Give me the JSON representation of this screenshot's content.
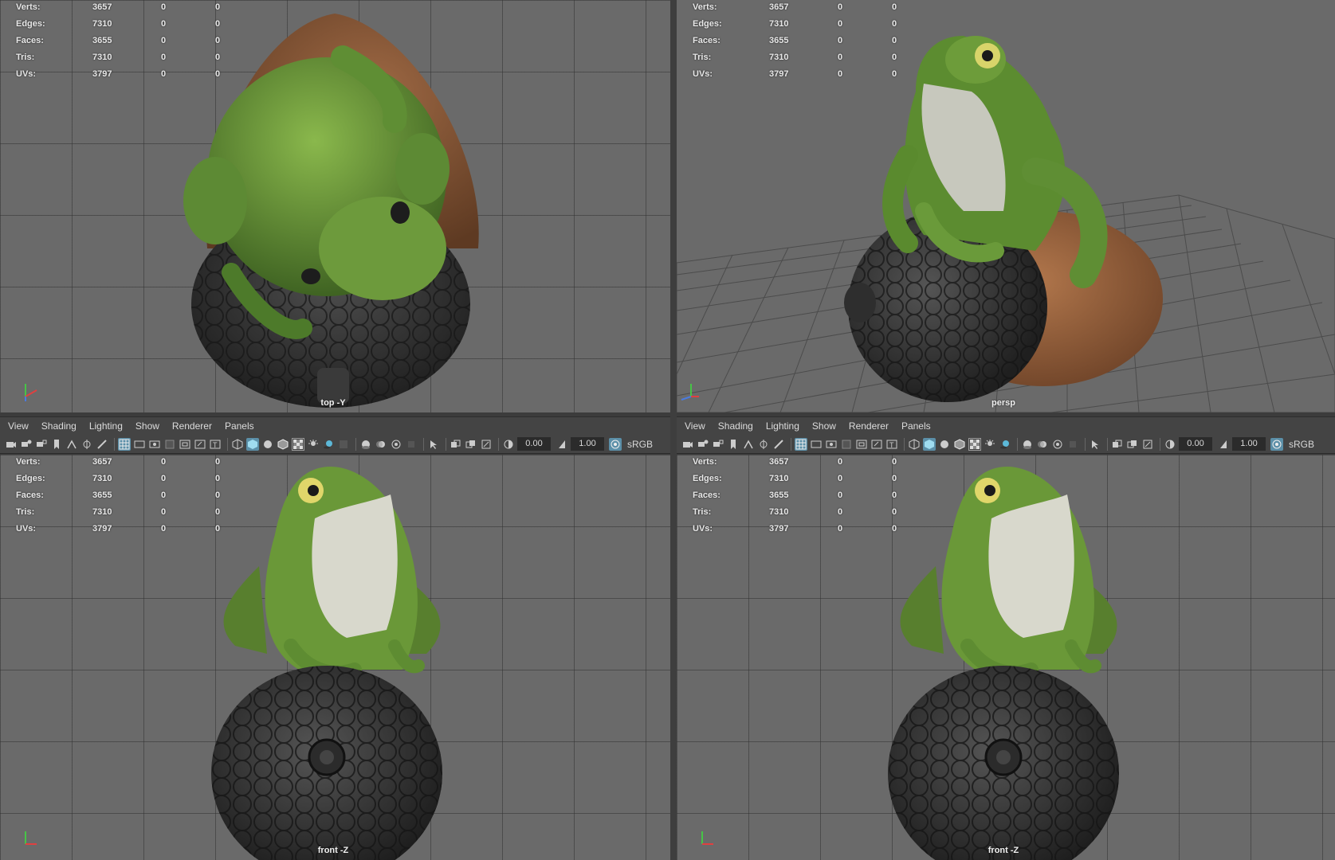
{
  "hud_labels": [
    "Verts:",
    "Edges:",
    "Faces:",
    "Tris:",
    "UVs:"
  ],
  "hud_values": [
    [
      "3657",
      "0",
      "0"
    ],
    [
      "7310",
      "0",
      "0"
    ],
    [
      "3655",
      "0",
      "0"
    ],
    [
      "7310",
      "0",
      "0"
    ],
    [
      "3797",
      "0",
      "0"
    ]
  ],
  "viewports": {
    "top_left": {
      "camera": "top -Y"
    },
    "top_right": {
      "camera": "persp"
    },
    "bottom_left": {
      "camera": "front -Z"
    },
    "bottom_right": {
      "camera": "front -Z"
    }
  },
  "menu": [
    "View",
    "Shading",
    "Lighting",
    "Show",
    "Renderer",
    "Panels"
  ],
  "toolbar": {
    "exposure": "0.00",
    "gamma": "1.00",
    "color_space": "sRGB"
  },
  "axis_labels": {
    "x": "x",
    "y": "y",
    "z": "z"
  },
  "colors": {
    "viewport_bg": "#6a6a6a",
    "panel_bg": "#444444",
    "active_icon": "#5b8fa8",
    "frog_green": "#6c9a3a",
    "acorn_cap": "#3a3a3a",
    "acorn_shell": "#8a5a3a"
  },
  "icons": [
    "camera-icon",
    "camera-attrs-icon",
    "bookmark-icon",
    "grid-icon",
    "wireframe-icon",
    "smooth-shade-icon",
    "xray-icon",
    "exposure-icon",
    "gamma-icon",
    "color-manage-icon"
  ]
}
